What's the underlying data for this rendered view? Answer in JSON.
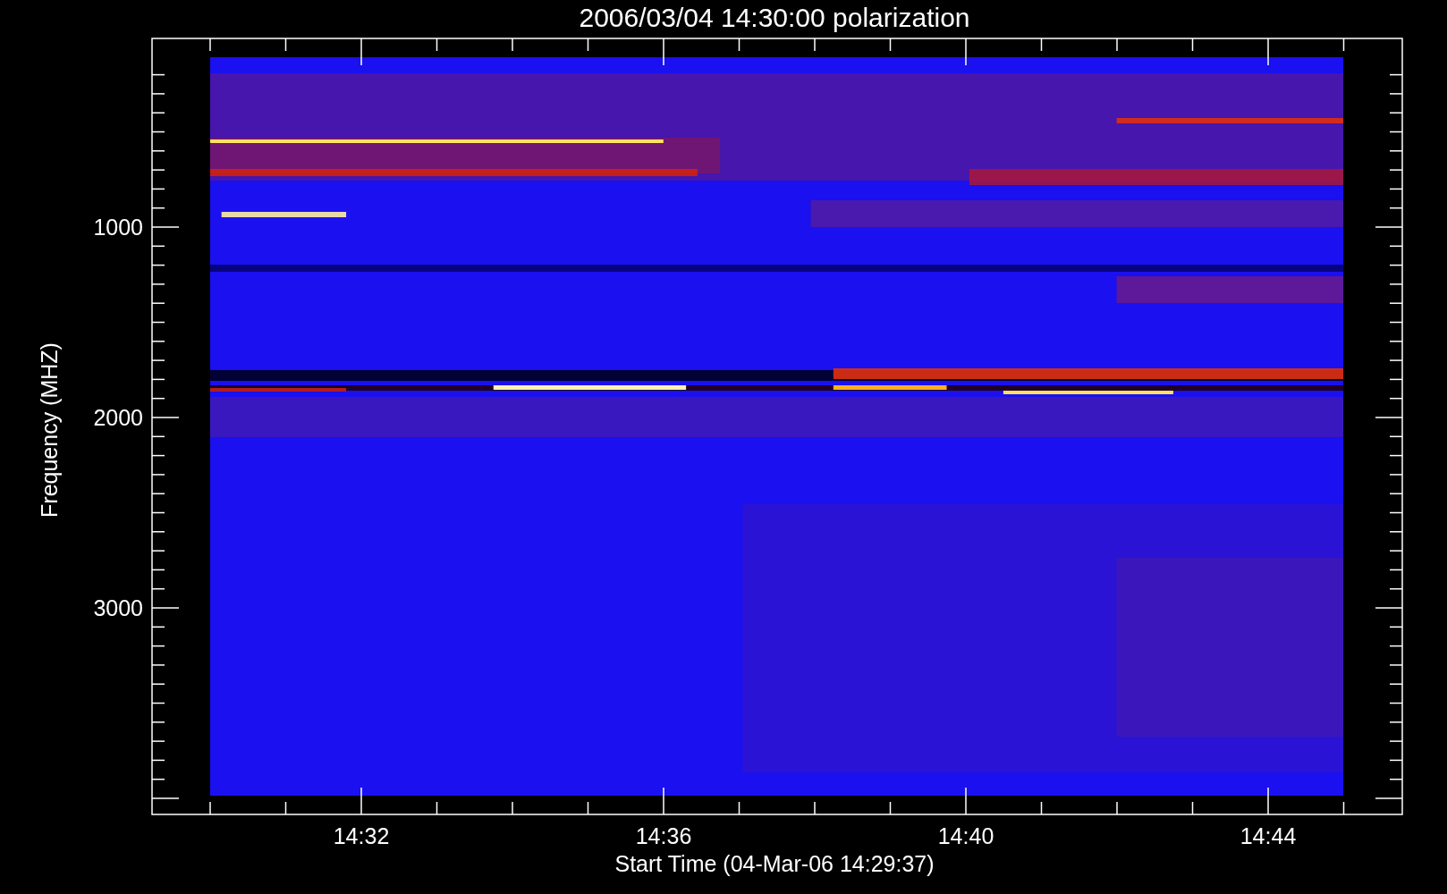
{
  "title": "2006/03/04 14:30:00 polarization",
  "y_axis": {
    "label": "Frequency (MHZ)",
    "ticks": [
      "1000",
      "2000",
      "3000"
    ]
  },
  "x_axis": {
    "label": "Start Time (04-Mar-06 14:29:37)",
    "ticks": [
      "14:32",
      "14:36",
      "14:40",
      "14:44"
    ]
  }
}
